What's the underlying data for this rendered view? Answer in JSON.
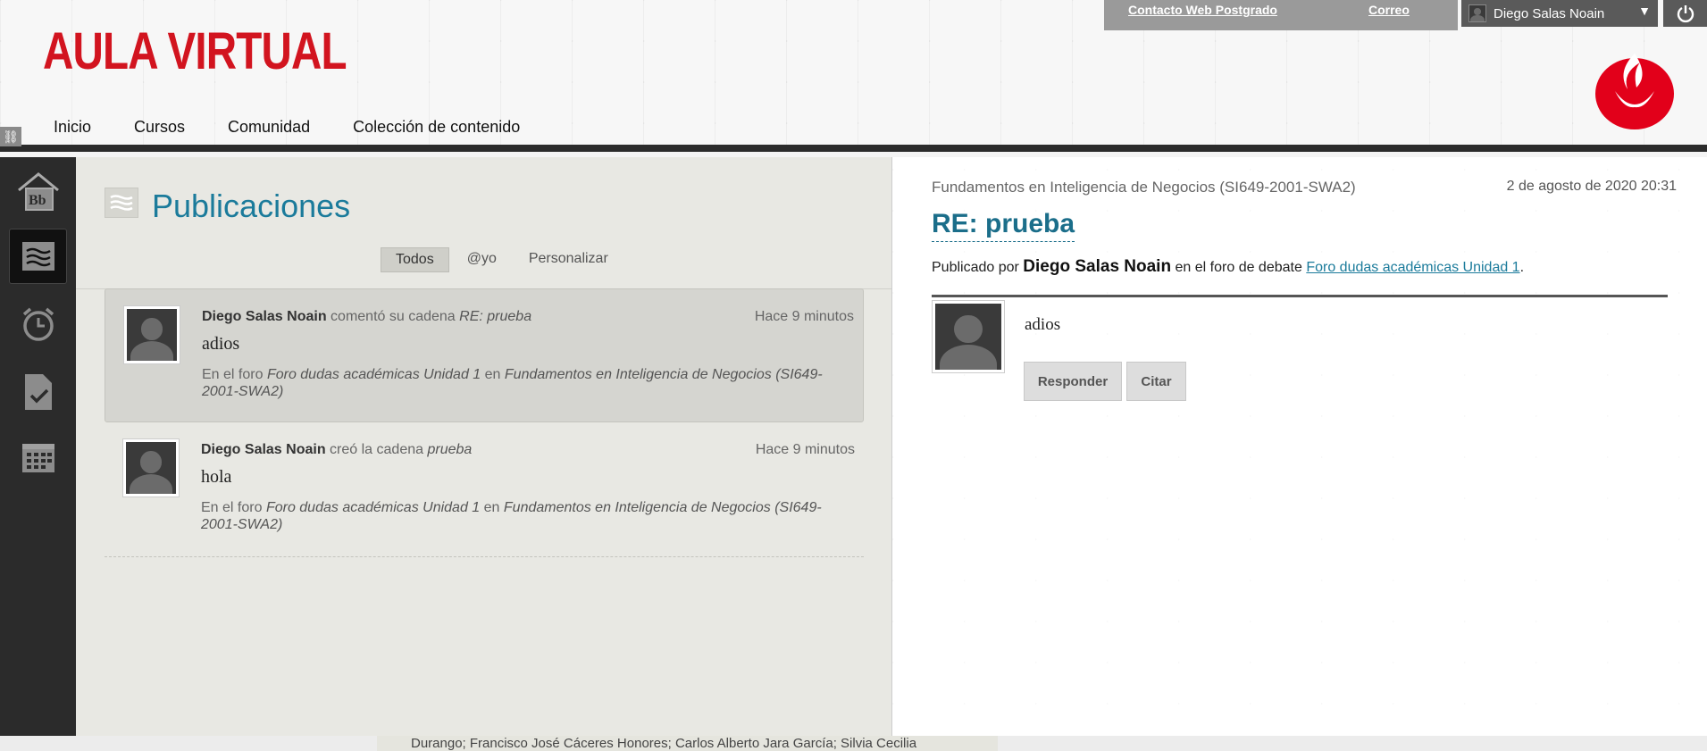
{
  "header": {
    "logo_text": "AULA VIRTUAL",
    "nav": [
      "Inicio",
      "Cursos",
      "Comunidad",
      "Colección de contenido"
    ],
    "top_links": {
      "contact": "Contacto Web Postgrado",
      "mail": "Correo"
    },
    "user_name": "Diego Salas Noain",
    "brand_color": "#d2141f"
  },
  "left_rail": {
    "items": [
      "bb-home-icon",
      "stream-icon",
      "alarm-clock-icon",
      "grades-icon",
      "calendar-icon"
    ],
    "active_index": 1
  },
  "stream": {
    "title": "Publicaciones",
    "filters": [
      "Todos",
      "@yo",
      "Personalizar"
    ],
    "active_filter": "Todos",
    "items": [
      {
        "author": "Diego Salas Noain",
        "action": "comentó su cadena",
        "thread": "RE: prueba",
        "time": "Hace 9 minutos",
        "body": "adios",
        "context_prefix": "En el foro",
        "forum": "Foro dudas académicas Unidad 1",
        "context_in": "en",
        "course": "Fundamentos en Inteligencia de Negocios (SI649-2001-SWA2)"
      },
      {
        "author": "Diego Salas Noain",
        "action": "creó la cadena",
        "thread": "prueba",
        "time": "Hace 9 minutos",
        "body": "hola",
        "context_prefix": "En el foro",
        "forum": "Foro dudas académicas Unidad 1",
        "context_in": "en",
        "course": "Fundamentos en Inteligencia de Negocios (SI649-2001-SWA2)"
      }
    ]
  },
  "detail": {
    "course": "Fundamentos en Inteligencia de Negocios (SI649-2001-SWA2)",
    "date": "2 de agosto de 2020 20:31",
    "title": "RE: prueba",
    "byline_prefix": "Publicado por",
    "author": "Diego Salas Noain",
    "byline_mid": "en el foro de debate",
    "forum_link": "Foro dudas académicas Unidad 1",
    "byline_end": ".",
    "body": "adios",
    "reply_label": "Responder",
    "quote_label": "Citar"
  },
  "bottom_text": "Durango;  Francisco José Cáceres Honores;  Carlos Alberto Jara García;  Silvia Cecilia"
}
